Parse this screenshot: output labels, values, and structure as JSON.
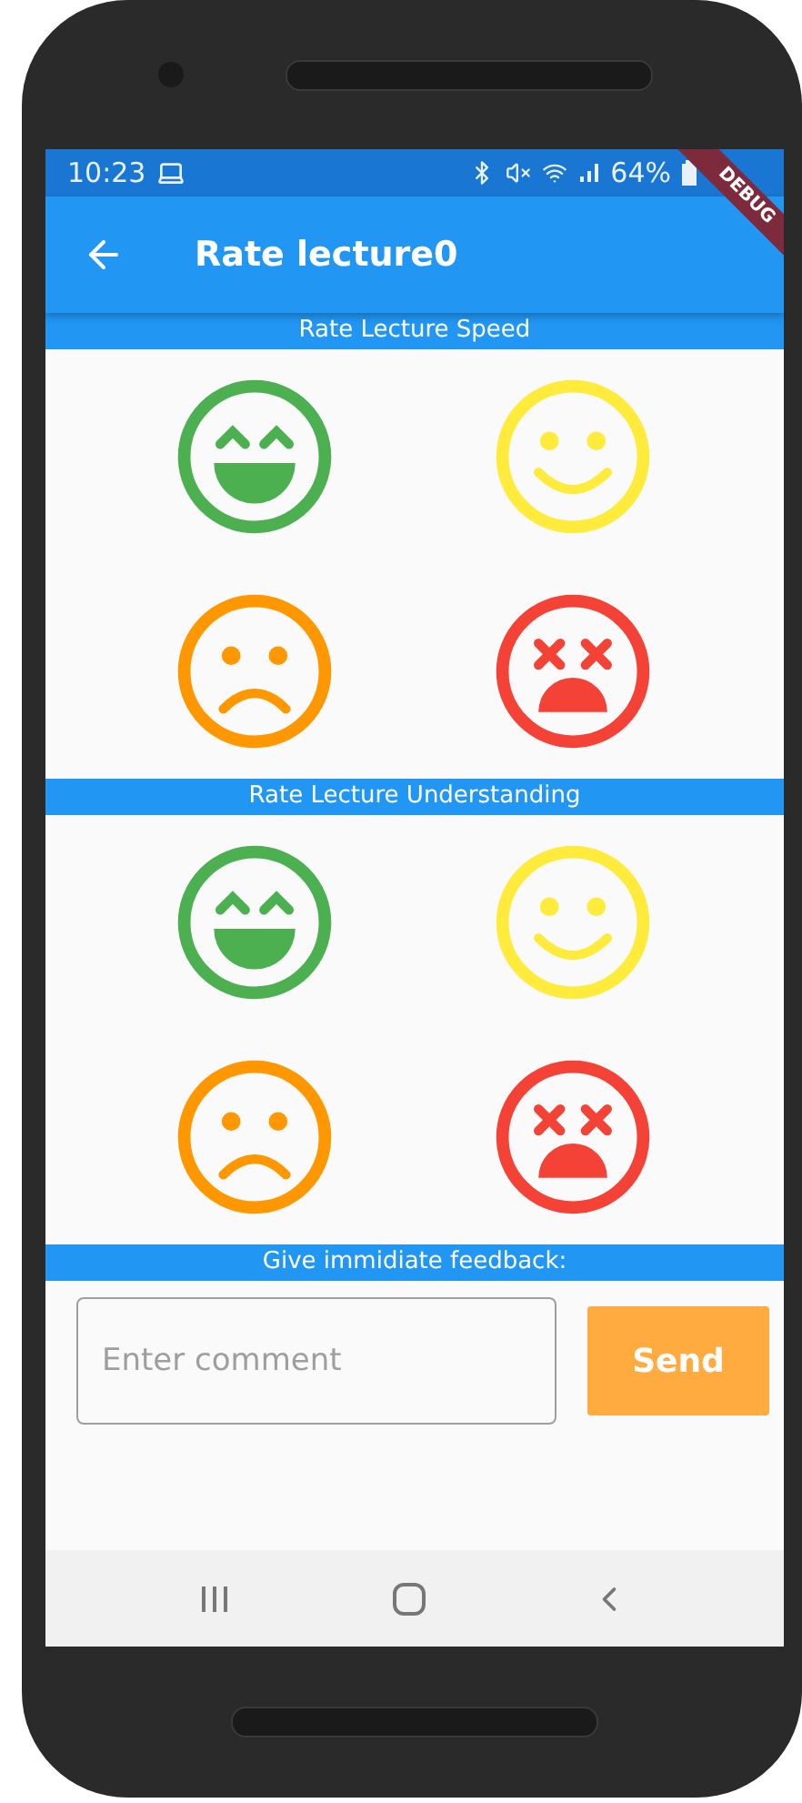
{
  "status_bar": {
    "time": "10:23",
    "battery": "64%"
  },
  "debug_banner": "DEBUG",
  "app_bar": {
    "title": "Rate lecture0"
  },
  "sections": [
    {
      "title": "Rate Lecture Speed",
      "ratings": [
        {
          "kind": "laughing",
          "color": "#4caf50"
        },
        {
          "kind": "smile",
          "color": "#ffeb3b"
        },
        {
          "kind": "sad",
          "color": "#ff9800"
        },
        {
          "kind": "dead",
          "color": "#f44336"
        }
      ]
    },
    {
      "title": "Rate Lecture Understanding",
      "ratings": [
        {
          "kind": "laughing",
          "color": "#4caf50"
        },
        {
          "kind": "smile",
          "color": "#ffeb3b"
        },
        {
          "kind": "sad",
          "color": "#ff9800"
        },
        {
          "kind": "dead",
          "color": "#f44336"
        }
      ]
    }
  ],
  "feedback": {
    "title": "Give immidiate feedback:",
    "placeholder": "Enter comment",
    "button": "Send"
  }
}
